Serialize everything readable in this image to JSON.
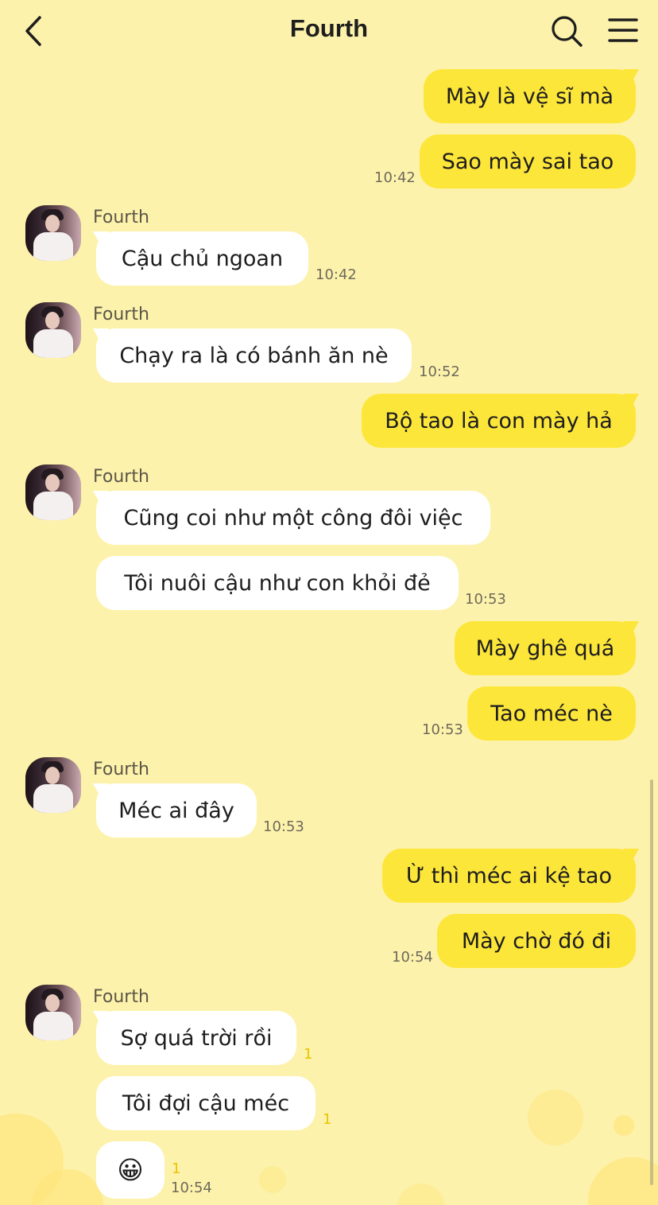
{
  "header": {
    "title": "Fourth"
  },
  "contact": {
    "name": "Fourth"
  },
  "messages": [
    {
      "text": "Mày là vệ sĩ mà"
    },
    {
      "text": "Sao mày sai tao",
      "time": "10:42"
    },
    {
      "text": "Cậu chủ ngoan",
      "time": "10:42"
    },
    {
      "text": "Chạy ra là có bánh ăn nè",
      "time": "10:52"
    },
    {
      "text": "Bộ tao là con mày hả"
    },
    {
      "text": "Cũng coi như một công đôi việc"
    },
    {
      "text": "Tôi nuôi cậu như con khỏi đẻ",
      "time": "10:53"
    },
    {
      "text": "Mày ghê quá"
    },
    {
      "text": "Tao méc nè",
      "time": "10:53"
    },
    {
      "text": "Méc ai đây",
      "time": "10:53"
    },
    {
      "text": "Ừ thì méc ai kệ tao"
    },
    {
      "text": "Mày chờ đó đi",
      "time": "10:54"
    },
    {
      "text": "Sợ quá trời rồi",
      "unread": "1"
    },
    {
      "text": "Tôi đợi cậu méc",
      "unread": "1"
    },
    {
      "text": "😀",
      "unread": "1",
      "time": "10:54"
    }
  ],
  "colors": {
    "background": "#fdf2ab",
    "my_bubble": "#fde63a",
    "their_bubble": "#ffffff",
    "unread": "#e8c400"
  },
  "icons": [
    "back-arrow-icon",
    "search-icon",
    "menu-icon"
  ]
}
